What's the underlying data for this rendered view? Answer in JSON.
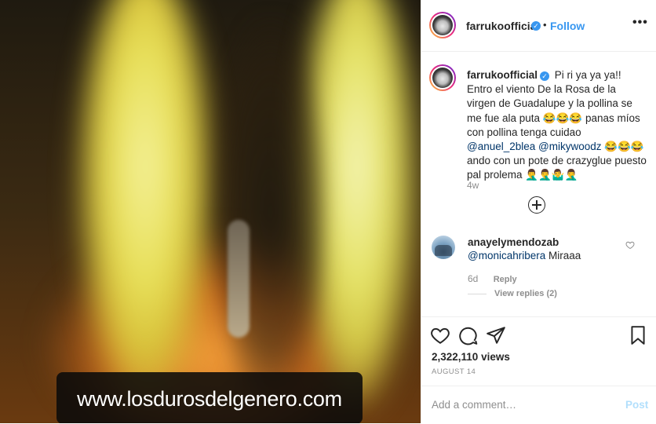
{
  "media": {
    "watermark": "www.losdurosdelgenero.com"
  },
  "header": {
    "username": "farrukoofficial",
    "separator": "•",
    "follow_label": "Follow",
    "more_label": "•••"
  },
  "caption": {
    "username": "farrukoofficial",
    "text_1": "Pi ri ya ya ya!! Entro el viento De la Rosa de la virgen de Guadalupe y la pollina se me fue ala puta 😂😂😂 panas míos con pollina tenga cuidao",
    "mention_1": "@anuel_2blea",
    "mention_2": "@mikywoodz",
    "text_2": "😂😂😂 ando con un pote de crazyglue puesto pal prolema 🤦‍♂️🤦‍♂️🤷‍♂️🤦‍♂️",
    "time": "4w"
  },
  "comment": {
    "username": "anayelymendozab",
    "mention": "@monicahribera",
    "text": "Miraaa",
    "time": "6d",
    "reply_label": "Reply",
    "view_replies": "View replies (2)"
  },
  "stats": {
    "views": "2,322,110 views",
    "date": "AUGUST 14"
  },
  "add_comment": {
    "placeholder": "Add a comment…",
    "post_label": "Post"
  },
  "colors": {
    "accent": "#3897f0",
    "mention": "#003569",
    "post_disabled": "#b2dffc"
  }
}
